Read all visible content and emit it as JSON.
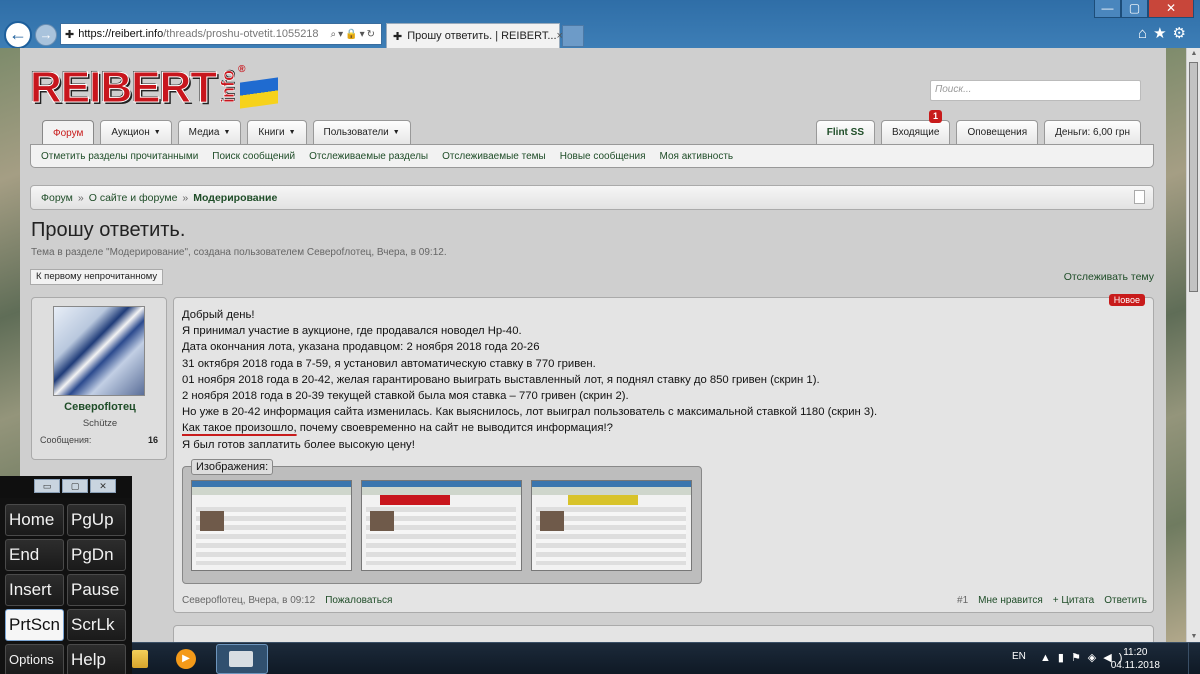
{
  "browser": {
    "url_host": "https://reibert.info",
    "url_path": "/threads/proshu-otvetit.1055218",
    "tab_title": "Прошу ответить. | REIBERT...",
    "tab_close": "×",
    "window_buttons": [
      "—",
      "▢",
      "✕"
    ],
    "right_icons": "⌂★⚙"
  },
  "site": {
    "logo_text": "REIBERT",
    "logo_sub": "info",
    "logo_reg": "®",
    "search_placeholder": "Поиск..."
  },
  "nav": {
    "tabs": [
      {
        "label": "Форум",
        "dropdown": false,
        "active": true
      },
      {
        "label": "Аукцион",
        "dropdown": true
      },
      {
        "label": "Медиа",
        "dropdown": true
      },
      {
        "label": "Книги",
        "dropdown": true
      },
      {
        "label": "Пользователи",
        "dropdown": true
      }
    ],
    "right_tabs": {
      "user": "Flint SS",
      "inbox": "Входящие",
      "inbox_badge": "1",
      "alerts": "Оповещения",
      "money": "Деньги: 6,00 грн"
    },
    "subnav": [
      "Отметить разделы прочитанными",
      "Поиск сообщений",
      "Отслеживаемые разделы",
      "Отслеживаемые темы",
      "Новые сообщения",
      "Моя активность"
    ]
  },
  "breadcrumb": {
    "items": [
      "Форум",
      "О сайте и форуме"
    ],
    "current": "Модерирование",
    "separator": "»"
  },
  "thread": {
    "title": "Прошу ответить.",
    "description": "Тема в разделе \"Модерирование\", создана пользователем Североfлотец, Вчера, в 09:12.",
    "first_unread_button": "К первому непрочитанному",
    "watch_link": "Отслеживать тему"
  },
  "post": {
    "author": "Североflотец",
    "author_title": "Schütze",
    "stat_label": "Сообщения:",
    "stat_value": "16",
    "new_badge": "Новое",
    "lines": [
      "Добрый день!",
      "Я принимал участие в аукционе, где продавался новодел Нр-40.",
      "Дата окончания лота, указана продавцом: 2 ноября 2018 года 20-26",
      "31 октября 2018 года в 7-59, я установил автоматическую ставку в 770 гривен.",
      "01 ноября 2018 года в 20-42, желая гарантировано выиграть выставленный лот, я поднял ставку до 850 гривен (скрин 1).",
      "2 ноября 2018 года в 20-39 текущей ставкой была моя ставка – 770 гривен (скрин 2).",
      "Но уже в 20-42 информация сайта изменилась. Как выяснилось, лот выиграл пользователь с максимальной ставкой 1180 (скрин 3)."
    ],
    "underlined_part": "Как такое произошло,",
    "line_rest": " почему своевременно на сайт не выводится информация!?",
    "last_line": "Я был готов заплатить более высокую цену!",
    "attachments_label": "Изображения:",
    "footer_meta": "Североflотец, Вчера, в 09:12",
    "report": "Пожаловаться",
    "post_number": "#1",
    "like": "Мне нравится",
    "quote": "+ Цитата",
    "reply": "Ответить"
  },
  "osk": {
    "title_buttons": [
      "▭",
      "▢",
      "✕"
    ],
    "keys": [
      "Home",
      "PgUp",
      "End",
      "PgDn",
      "Insert",
      "Pause",
      "PrtScn",
      "ScrLk",
      "Options",
      "Help"
    ],
    "selected_key": "PrtScn"
  },
  "taskbar": {
    "media_icon": "▶",
    "lang": "EN",
    "tray_icons": "▲▮⚑◈◀)",
    "time": "11:20",
    "date": "04.11.2018"
  },
  "colors": {
    "link_green": "#1f4d28",
    "accent_red": "#c81b1b",
    "browser_blue": "#2f6ea7"
  }
}
